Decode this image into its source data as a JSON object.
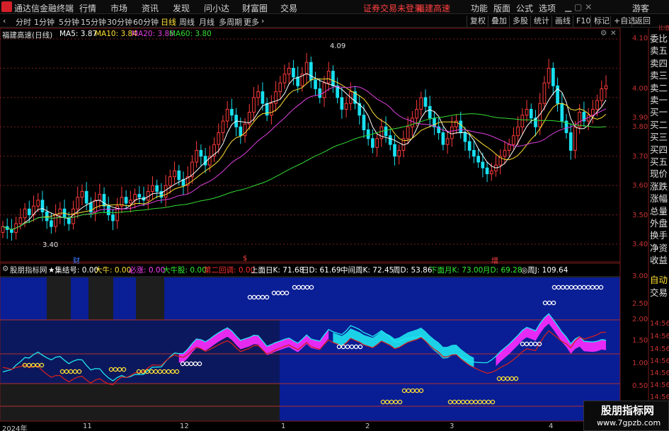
{
  "app": {
    "title": "通达信金融终端"
  },
  "menu": {
    "items": [
      "行情",
      "市场",
      "资讯",
      "发现",
      "问小达",
      "财富圈",
      "交易"
    ],
    "notice": "证券交易未登录",
    "stock_name": "福建高速",
    "right_items": [
      "功能",
      "版面",
      "公式",
      "选项"
    ],
    "guest": "游客"
  },
  "toolbar": {
    "periods": [
      "分时",
      "1分钟",
      "5分钟",
      "15分钟",
      "30分钟",
      "60分钟",
      "日线",
      "周线",
      "月线",
      "多周期",
      "更多"
    ],
    "active_period": "日线",
    "right": [
      "复权",
      "叠加",
      "多股",
      "统计",
      "画线",
      "F10",
      "标记",
      "+自选",
      "返回"
    ]
  },
  "chart_header": {
    "title": "福建高速(日线)",
    "ma": [
      {
        "label": "MA5: 3.87",
        "color": "#ffffff"
      },
      {
        "label": "MA10: 3.84",
        "color": "#ffe033"
      },
      {
        "label": "MA20: 3.86",
        "color": "#e040e0"
      },
      {
        "label": "MA60: 3.80",
        "color": "#33dd33"
      }
    ]
  },
  "price_axis": {
    "ticks": [
      "4.10",
      "4.00",
      "3.90",
      "3.80",
      "3.70",
      "3.60",
      "3.50",
      "3.40"
    ],
    "partial": "比值"
  },
  "annotations": {
    "high": "4.09",
    "low": "3.40",
    "events": [
      "财",
      "$",
      "增"
    ]
  },
  "indicator": {
    "name": "股朋指标网",
    "values": [
      {
        "label": "★集结号: 0.00",
        "color": "#ffffff"
      },
      {
        "label": "大牛: 0.00",
        "color": "#ffe033"
      },
      {
        "label": "必涨: 0.00",
        "color": "#ff40ff"
      },
      {
        "label": "大牛股: 0.00",
        "color": "#33ee33"
      },
      {
        "label": "第二回调: 0.00",
        "color": "#ff3030"
      },
      {
        "label": "上面日K: 71.68",
        "color": "#ffffff"
      },
      {
        "label": "日D: 61.69",
        "color": "#ffffff"
      },
      {
        "label": "中间周K: 72.45",
        "color": "#ffffff"
      },
      {
        "label": "周D: 53.86",
        "color": "#ffffff"
      },
      {
        "label": "下面月K: 73.00",
        "color": "#33ee33"
      },
      {
        "label": "月D: 69.28",
        "color": "#33ee33"
      },
      {
        "label": "◎周J: 109.64",
        "color": "#ffffff"
      }
    ],
    "axis": [
      "3.00",
      "2.50",
      "2.00",
      "1.50",
      "1.00",
      "0.50"
    ],
    "axis_overlay": "14:56"
  },
  "x_axis": {
    "labels": [
      "2024年",
      "11",
      "12",
      "1",
      "2",
      "3",
      "4"
    ]
  },
  "right_panel": {
    "tabs": [
      "委比",
      "卖五",
      "卖四",
      "卖三",
      "卖二",
      "卖一",
      "买一",
      "买二",
      "买三",
      "买四",
      "买五",
      "现价",
      "涨跌",
      "涨幅",
      "总量",
      "外盘",
      "换手",
      "净资",
      "收益"
    ],
    "bottom_tabs": [
      "自动",
      "交易"
    ]
  },
  "watermark": {
    "line1": "股朋指标网",
    "line2": "www.7gpzb.com"
  },
  "colors": {
    "up": "#ff3b3b",
    "down": "#18e0f0",
    "grid": "#7a1c1c",
    "blue_zone": "#0a1f9c",
    "magenta": "#ff2cff",
    "cyan": "#1fe6f0"
  }
}
